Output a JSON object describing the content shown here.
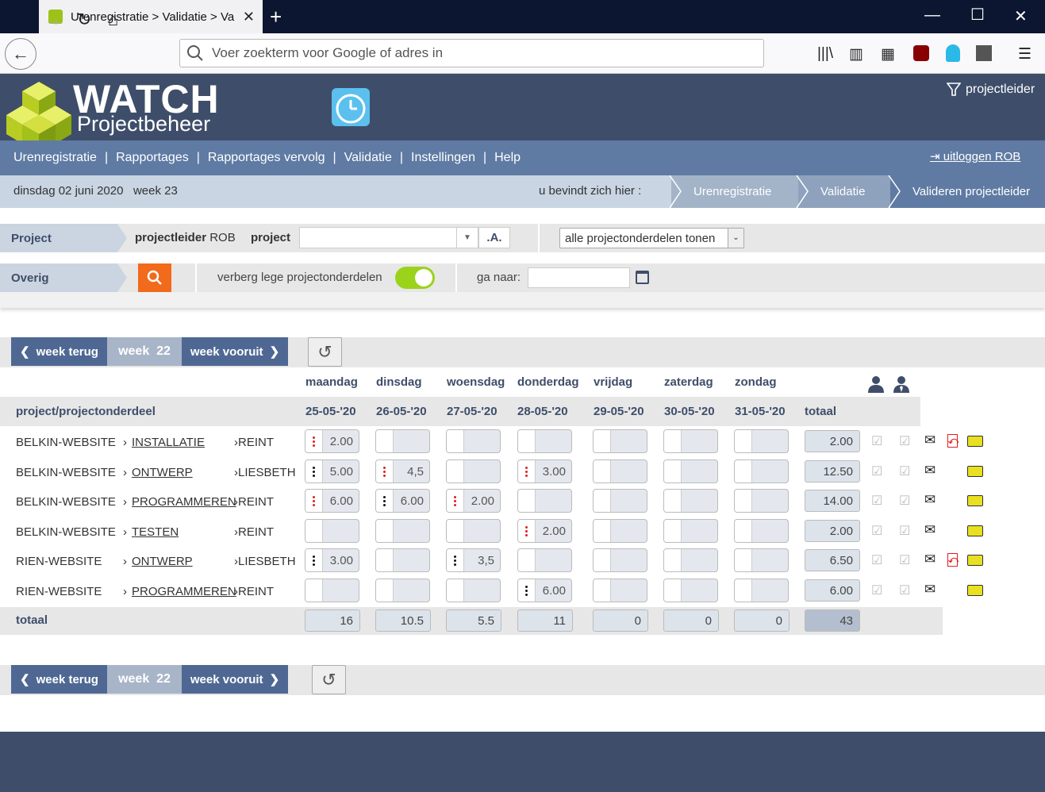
{
  "browser": {
    "tab_title": "Urenregistratie > Validatie > Va",
    "url_placeholder": "Voer zoekterm voor Google of adres in"
  },
  "app": {
    "logo_title": "WATCH",
    "logo_subtitle": "Projectbeheer",
    "role_filter": "projectleider",
    "logout": "uitloggen ROB"
  },
  "menu": [
    "Urenregistratie",
    "Rapportages",
    "Rapportages vervolg",
    "Validatie",
    "Instellingen",
    "Help"
  ],
  "status": {
    "date": "dinsdag 02 juni 2020",
    "week": "week 23",
    "location_label": "u bevindt zich hier :"
  },
  "breadcrumb": [
    "Urenregistratie",
    "Validatie",
    "Valideren projectleider"
  ],
  "filters": {
    "project_label": "Project",
    "projectleider_label": "projectleider",
    "projectleider_value": "ROB",
    "project_field_label": "project",
    "project_value": "",
    "a_button": ".A.",
    "projectonderdelen_select": "alle projectonderdelen tonen",
    "overig_label": "Overig",
    "hide_empty_label": "verberg lege projectonderdelen",
    "goto_label": "ga naar:",
    "goto_value": ""
  },
  "weeknav": {
    "back": "week terug",
    "current_label": "week",
    "current_number": "22",
    "forward": "week vooruit"
  },
  "table": {
    "days": [
      "maandag",
      "dinsdag",
      "woensdag",
      "donderdag",
      "vrijdag",
      "zaterdag",
      "zondag"
    ],
    "col_project": "project/projectonderdeel",
    "dates": [
      "25-05-'20",
      "26-05-'20",
      "27-05-'20",
      "28-05-'20",
      "29-05-'20",
      "30-05-'20",
      "31-05-'20"
    ],
    "col_total": "totaal",
    "rows": [
      {
        "project": "BELKIN-WEBSITE",
        "part": "INSTALLATIE",
        "person": "REINT",
        "hours": [
          "2.00",
          "",
          "",
          "",
          "",
          "",
          ""
        ],
        "dots": [
          "red",
          "",
          "",
          "",
          "",
          "",
          ""
        ],
        "total": "2.00",
        "pdf": true
      },
      {
        "project": "BELKIN-WEBSITE",
        "part": "ONTWERP",
        "person": "LIESBETH",
        "hours": [
          "5.00",
          "4,5",
          "",
          "3.00",
          "",
          "",
          ""
        ],
        "dots": [
          "black",
          "red",
          "",
          "red",
          "",
          "",
          ""
        ],
        "total": "12.50",
        "pdf": false
      },
      {
        "project": "BELKIN-WEBSITE",
        "part": "PROGRAMMEREN",
        "person": "REINT",
        "hours": [
          "6.00",
          "6.00",
          "2.00",
          "",
          "",
          "",
          ""
        ],
        "dots": [
          "red",
          "black",
          "red",
          "",
          "",
          "",
          ""
        ],
        "total": "14.00",
        "pdf": false
      },
      {
        "project": "BELKIN-WEBSITE",
        "part": "TESTEN",
        "person": "REINT",
        "hours": [
          "",
          "",
          "",
          "2.00",
          "",
          "",
          ""
        ],
        "dots": [
          "",
          "",
          "",
          "red",
          "",
          "",
          ""
        ],
        "total": "2.00",
        "pdf": false
      },
      {
        "project": "RIEN-WEBSITE",
        "part": "ONTWERP",
        "person": "LIESBETH",
        "hours": [
          "3.00",
          "",
          "3,5",
          "",
          "",
          "",
          ""
        ],
        "dots": [
          "black",
          "",
          "black",
          "",
          "",
          "",
          ""
        ],
        "total": "6.50",
        "pdf": true
      },
      {
        "project": "RIEN-WEBSITE",
        "part": "PROGRAMMEREN",
        "person": "REINT",
        "hours": [
          "",
          "",
          "",
          "6.00",
          "",
          "",
          ""
        ],
        "dots": [
          "",
          "",
          "",
          "black",
          "",
          "",
          ""
        ],
        "total": "6.00",
        "pdf": false
      }
    ],
    "totals_label": "totaal",
    "totals": [
      "16",
      "10.5",
      "5.5",
      "11",
      "0",
      "0",
      "0"
    ],
    "grand_total": "43"
  },
  "colors": {
    "header_bg": "#3e4e6a",
    "menu_bg": "#5f7ba3",
    "accent_orange": "#f26a1b",
    "toggle_green": "#9bd21a"
  }
}
